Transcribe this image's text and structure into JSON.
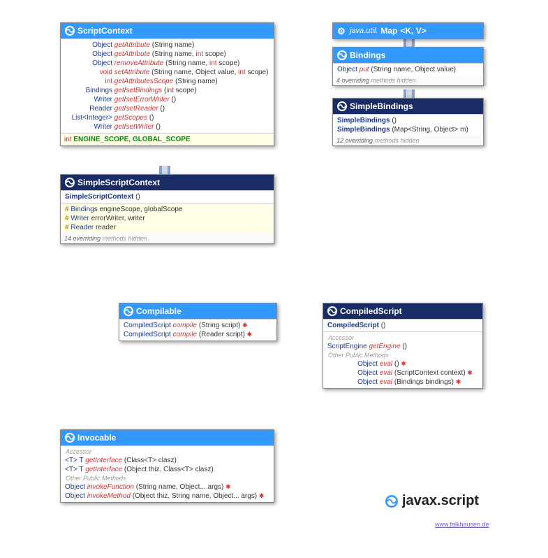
{
  "scriptContext": {
    "title": "ScriptContext",
    "rows": [
      {
        "ret": "Object",
        "retW": 58,
        "meth": "getAttribute",
        "sig": "(String name)"
      },
      {
        "ret": "Object",
        "retW": 58,
        "meth": "getAttribute",
        "sig": "(String name, ",
        "prim": "int",
        "sig2": " scope)"
      },
      {
        "ret": "Object",
        "retW": 58,
        "meth": "removeAttribute",
        "sig": "(String name, ",
        "prim": "int",
        "sig2": " scope)"
      },
      {
        "ret": "void",
        "retW": 58,
        "retPrim": true,
        "meth": "setAttribute",
        "sig": "(String name, Object value, ",
        "prim": "int",
        "sig2": " scope)"
      },
      {
        "ret": "int",
        "retW": 58,
        "retPrim": true,
        "meth": "getAttributesScope",
        "sig": "(String name)"
      },
      {
        "ret": "Bindings",
        "retW": 58,
        "meth": "get",
        "meth2": "setBindings",
        "sig": "(",
        "prim": "int",
        "sig2": " scope)"
      },
      {
        "ret": "Writer",
        "retW": 58,
        "meth": "get",
        "meth2": "setErrorWriter",
        "sig": "()"
      },
      {
        "ret": "Reader",
        "retW": 58,
        "meth": "get",
        "meth2": "setReader",
        "sig": "()"
      },
      {
        "ret": "List<Integer>",
        "retW": 58,
        "meth": "getScopes",
        "sig": "()"
      },
      {
        "ret": "Writer",
        "retW": 58,
        "meth": "get",
        "meth2": "setWriter",
        "sig": "()"
      }
    ],
    "constRet": "int",
    "const1": "ENGINE_SCOPE",
    "const2": "GLOBAL_SCOPE"
  },
  "simpleScriptContext": {
    "title": "SimpleScriptContext",
    "ctor": "SimpleScriptContext",
    "ctorSig": "()",
    "fields": [
      {
        "type": "Bindings",
        "names": "engineScope, globalScope"
      },
      {
        "type": "Writer",
        "names": "errorWriter, writer"
      },
      {
        "type": "Reader",
        "names": "reader"
      }
    ],
    "hidden": "14 overriding",
    "hidden2": " methods hidden"
  },
  "map": {
    "pkg": "java.util.",
    "title": "Map",
    "generic": "<K, V>"
  },
  "bindings": {
    "title": "Bindings",
    "row": {
      "ret": "Object",
      "meth": "put",
      "sig": "(String name, Object value)"
    },
    "hidden": "4 overriding",
    "hidden2": " methods hidden"
  },
  "simpleBindings": {
    "title": "SimpleBindings",
    "ctor1": "SimpleBindings",
    "ctor1Sig": "()",
    "ctor2": "SimpleBindings",
    "ctor2Sig": "(Map<String, Object> m)",
    "hidden": "12 overriding",
    "hidden2": " methods hidden"
  },
  "compilable": {
    "title": "Compilable",
    "rows": [
      {
        "ret": "CompiledScript",
        "meth": "compile",
        "sig": "(String script)",
        "ex": true
      },
      {
        "ret": "CompiledScript",
        "meth": "compile",
        "sig": "(Reader script)",
        "ex": true
      }
    ]
  },
  "compiledScript": {
    "title": "CompiledScript",
    "ctor": "CompiledScript",
    "ctorSig": "()",
    "accessor": "Accessor",
    "acc": {
      "ret": "ScriptEngine",
      "meth": "getEngine",
      "sig": "()"
    },
    "otherLabel": "Other Public Methods",
    "rows": [
      {
        "ret": "Object",
        "retW": 60,
        "meth": "eval",
        "sig": "()",
        "ex": true
      },
      {
        "ret": "Object",
        "retW": 60,
        "meth": "eval",
        "sig": "(ScriptContext context)",
        "ex": true
      },
      {
        "ret": "Object",
        "retW": 60,
        "meth": "eval",
        "sig": "(Bindings bindings)",
        "ex": true
      }
    ]
  },
  "invocable": {
    "title": "Invocable",
    "accessor": "Accessor",
    "accRows": [
      {
        "ret": "<T> T",
        "meth": "getInterface",
        "sig": "(Class<T> clasz)"
      },
      {
        "ret": "<T> T",
        "meth": "getInterface",
        "sig": "(Object thiz, Class<T> clasz)"
      }
    ],
    "otherLabel": "Other Public Methods",
    "rows": [
      {
        "ret": "Object",
        "meth": "invokeFunction",
        "sig": "(String name, Object... args)",
        "ex": true
      },
      {
        "ret": "Object",
        "meth": "invokeMethod",
        "sig": "(Object thiz, String name, Object... args)",
        "ex": true
      }
    ]
  },
  "package": "javax.script",
  "credit": "www.falkhausen.de"
}
